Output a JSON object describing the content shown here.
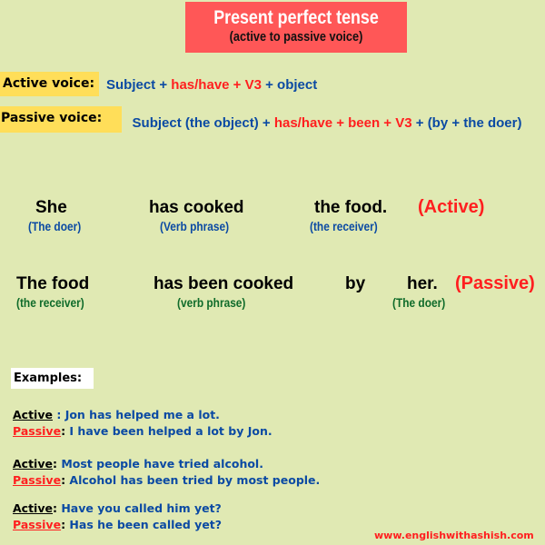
{
  "header": {
    "title": "Present perfect tense",
    "subtitle": "(active to passive voice)"
  },
  "rules": {
    "active": {
      "label": "Active voice:",
      "parts": [
        {
          "text": "Subject",
          "color": "blue"
        },
        {
          "text": " + ",
          "color": "blue"
        },
        {
          "text": "has/have + V3",
          "color": "red"
        },
        {
          "text": " + object",
          "color": "blue"
        }
      ]
    },
    "passive": {
      "label": "Passive voice:",
      "parts": [
        {
          "text": "Subject (the object) + ",
          "color": "blue"
        },
        {
          "text": "has/have + been + V3",
          "color": "red"
        },
        {
          "text": " + (by + the doer)",
          "color": "blue"
        }
      ]
    }
  },
  "active_example": {
    "subject": "She",
    "subject_role": "(The doer)",
    "verb": "has cooked",
    "verb_role": "(Verb phrase)",
    "object": "the food.",
    "object_role": "(the receiver)",
    "tag": "(Active)"
  },
  "passive_example": {
    "subject": "The food",
    "subject_role": "(the receiver)",
    "verb": "has been cooked",
    "verb_role": "(verb phrase)",
    "by": "by",
    "agent": "her.",
    "agent_role": "(The doer)",
    "tag": "(Passive)"
  },
  "examples": {
    "heading": "Examples:",
    "pairs": [
      {
        "active_label": "Active",
        "active_sep": " : ",
        "active_text": "Jon has helped me a lot.",
        "passive_label": "Passive",
        "passive_sep": ": ",
        "passive_text": "I have been helped a lot by Jon."
      },
      {
        "active_label": "Active",
        "active_sep": ": ",
        "active_text": "Most people have tried alcohol.",
        "passive_label": "Passive",
        "passive_sep": ": ",
        "passive_text": "Alcohol has been tried by most people."
      },
      {
        "active_label": "Active",
        "active_sep": ": ",
        "active_text": "Have you called him yet?",
        "passive_label": "Passive",
        "passive_sep": ": ",
        "passive_text": "Has he been called yet?"
      }
    ]
  },
  "footer": {
    "website": "www.englishwithashish.com"
  },
  "colors": {
    "background": "#e0e9b3",
    "title_box": "#ff5757",
    "label_box": "#ffde59",
    "blue": "#0b4aa3",
    "red": "#ff1f1f",
    "green": "#0f6b2a"
  }
}
